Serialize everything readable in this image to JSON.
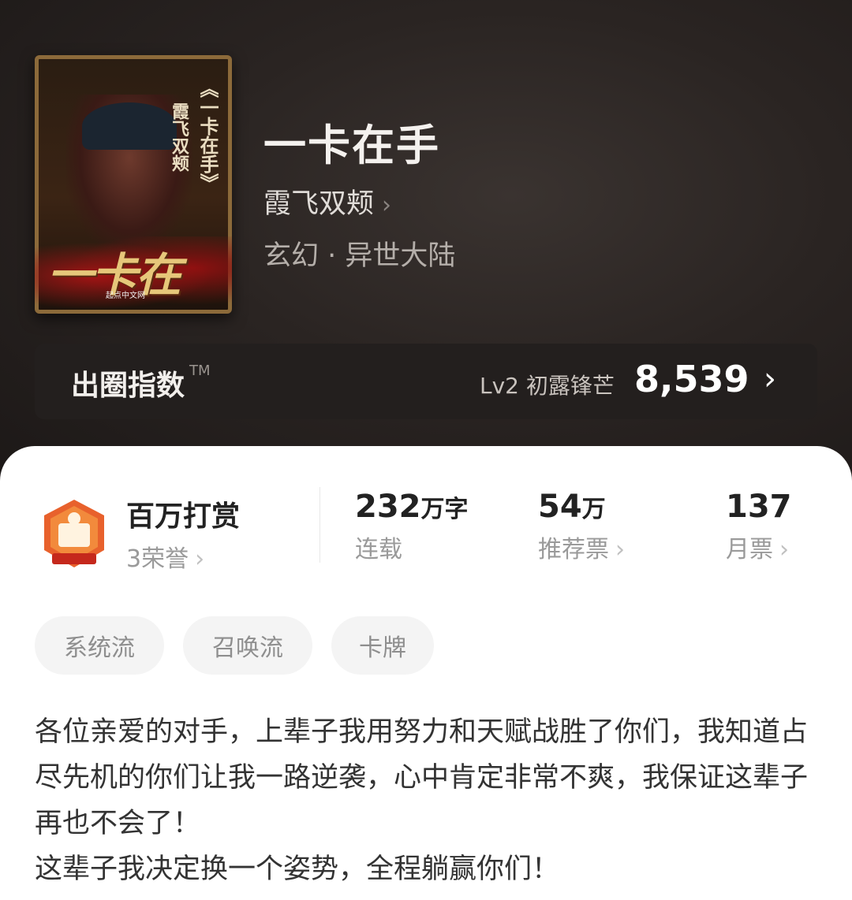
{
  "book": {
    "title": "一卡在手",
    "author": "霞飞双颊",
    "genre": "玄幻 · 异世大陆",
    "cover": {
      "vertical_title": "《一卡在手》",
      "vertical_author": "霞飞双颊",
      "big_title": "一卡在手",
      "publisher": "起点中文网"
    }
  },
  "index": {
    "label": "出圈指数",
    "tm": "TM",
    "level": "Lv2 初露锋芒",
    "score": "8,539"
  },
  "stats": {
    "badge_title": "百万打赏",
    "badge_sub": "3荣誉",
    "words_value": "232",
    "words_unit": "万字",
    "words_label": "连载",
    "recommend_value": "54",
    "recommend_unit": "万",
    "recommend_label": "推荐票",
    "monthly_value": "137",
    "monthly_label": "月票"
  },
  "tags": [
    "系统流",
    "召唤流",
    "卡牌"
  ],
  "synopsis": [
    "各位亲爱的对手，上辈子我用努力和天赋战胜了你们，我知道占尽先机的你们让我一路逆袭，心中肯定非常不爽，我保证这辈子再也不会了！",
    "这辈子我决定换一个姿势，全程躺赢你们！"
  ],
  "colors": {
    "hero_bg": "#2a2422",
    "score": "#ffffff",
    "badge_orange": "#e8612c"
  }
}
